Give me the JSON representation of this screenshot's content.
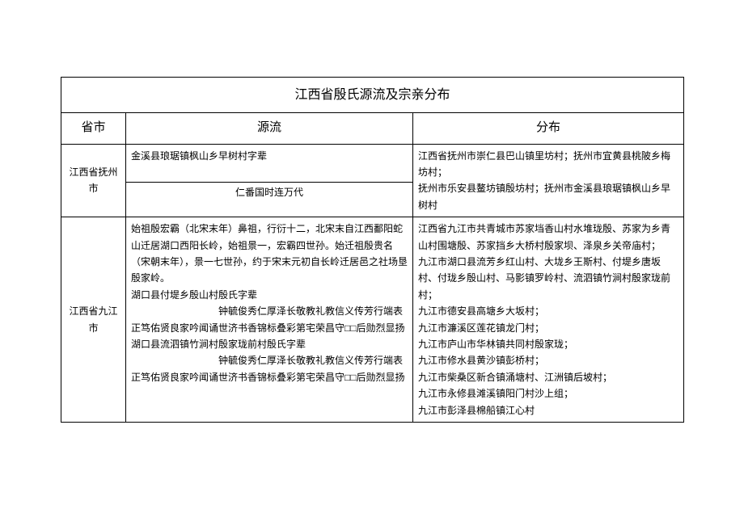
{
  "title": "江西省殷氏源流及宗亲分布",
  "headers": {
    "province": "省市",
    "source": "源流",
    "distribution": "分布"
  },
  "rows": [
    {
      "province": "江西省抚州市",
      "source_line1": "金溪县琅琚镇枫山乡早树村字辈",
      "source_line2": "仁番国时连万代",
      "distribution": "江西省抚州市崇仁县巴山镇里坊村；抚州市宜黄县桃陂乡梅坊村；\n抚州市乐安县鳌坊镇殷坊村；抚州市金溪县琅琚镇枫山乡早树村"
    },
    {
      "province": "江西省九江市",
      "source": "始祖殷宏霸（北宋末年）鼻祖，行衍十二，北宋末自江西鄱阳蛇山迁居湖口西阳长岭，始祖景一，宏霸四世孙。始迁祖殷贵名（宋朝末年），景一七世孙，约于宋末元初自长岭迁居邑之社场垦殷家岭。\n湖口县付堤乡殷山村殷氏字辈\n　　　　　　　　　钟毓俊秀仁厚泽长敬教礼教信义传芳行端表正笃佑贤良家吟闻诵世济书香锦标叠彩第宅荣昌守□□后勋烈显扬湖口县流泗镇竹涧村殷家珑前村殷氏字辈\n　　　　　　　　　钟毓俊秀仁厚泽长敬教礼教信义传芳行端表正笃佑贤良家吟闻诵世济书香锦标叠彩第宅荣昌守□□后勋烈显扬",
      "distribution": "江西省九江市共青城市苏家垱香山村水堆珑殷、苏家为乡青山村围塘殷、苏家挡乡大桥村殷家坝、泽泉乡关帝庙村；\n九江市湖口县流芳乡红山村、大垅乡王斯村、付堤乡唐坂村、付珑乡殷山村、马影镇罗岭村、流泗镇竹涧村殷家珑前村；\n九江市德安县高塘乡大坂村；\n九江市濂溪区莲花镇龙门村；\n九江市庐山市华林镇共同村殷家珑；\n九江市修水县黄沙镇彭桥村；\n九江市柴桑区新合镇涌塘村、江洲镇后坡村；\n九江市永修县滩溪镇阳门村沙上组；\n九江市彭泽县棉船镇江心村"
    }
  ]
}
